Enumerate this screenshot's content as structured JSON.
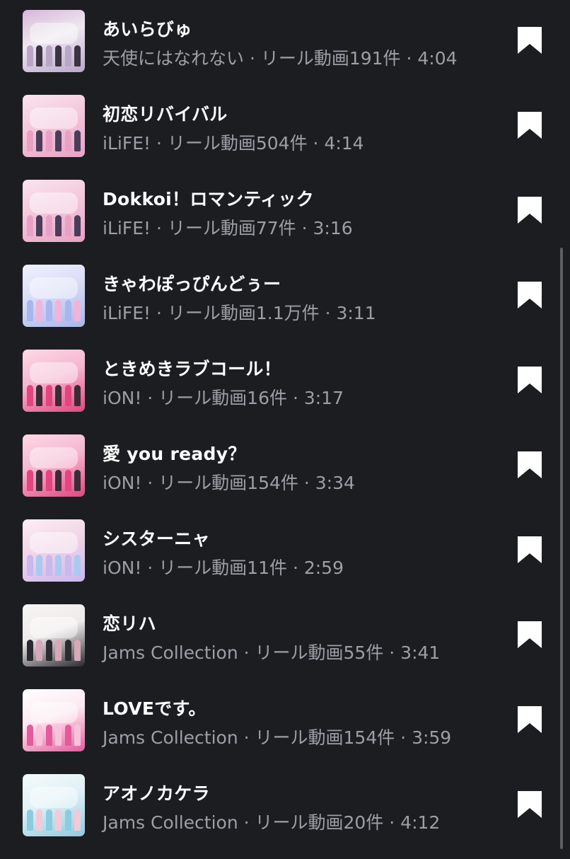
{
  "tracks": [
    {
      "title": "あいらびゅ",
      "subtitle": "天使にはなれない · リール動画191件 · 4:04",
      "thumb_colors": [
        "#eee8ef",
        "#b9a6c8",
        "#3a3440",
        "#d7b7d9"
      ],
      "bookmark_icon": "bookmark-icon"
    },
    {
      "title": "初恋リバイバル",
      "subtitle": "iLiFE! · リール動画504件 · 4:14",
      "thumb_colors": [
        "#f3c8dc",
        "#e8a1c4",
        "#4a3d58",
        "#fbe4ef"
      ],
      "bookmark_icon": "bookmark-icon"
    },
    {
      "title": "Dokkoi！ロマンティック",
      "subtitle": "iLiFE! · リール動画77件 · 3:16",
      "thumb_colors": [
        "#f3c8dc",
        "#e8a1c4",
        "#4a3d58",
        "#fbe4ef"
      ],
      "bookmark_icon": "bookmark-icon"
    },
    {
      "title": "きゃわぽっぴんどぅー",
      "subtitle": "iLiFE! · リール動画1.1万件 · 3:11",
      "thumb_colors": [
        "#d9dcf5",
        "#a8b6ee",
        "#f2b3d8",
        "#f0f2ff"
      ],
      "bookmark_icon": "bookmark-icon"
    },
    {
      "title": "ときめきラブコール！",
      "subtitle": "iON! · リール動画16件 · 3:17",
      "thumb_colors": [
        "#f4b6cf",
        "#e2457f",
        "#3b2b36",
        "#ffd9e6"
      ],
      "bookmark_icon": "bookmark-icon"
    },
    {
      "title": "愛 you ready？",
      "subtitle": "iON! · リール動画154件 · 3:34",
      "thumb_colors": [
        "#f4b6cf",
        "#e2457f",
        "#3b2b36",
        "#ffd9e6"
      ],
      "bookmark_icon": "bookmark-icon"
    },
    {
      "title": "シスターニャ",
      "subtitle": "iON! · リール動画11件 · 2:59",
      "thumb_colors": [
        "#f2d4e6",
        "#c9b8ee",
        "#a9c9f2",
        "#fbeff6"
      ],
      "bookmark_icon": "bookmark-icon"
    },
    {
      "title": "恋リハ",
      "subtitle": "Jams Collection · リール動画55件 · 3:41",
      "thumb_colors": [
        "#eeeaea",
        "#2b2b2f",
        "#d9a7b8",
        "#f7f4f4"
      ],
      "bookmark_icon": "bookmark-icon"
    },
    {
      "title": "LOVEです。",
      "subtitle": "Jams Collection · リール動画154件 · 3:59",
      "thumb_colors": [
        "#fbe9f1",
        "#e35b9a",
        "#f7c3da",
        "#ffffff"
      ],
      "bookmark_icon": "bookmark-icon"
    },
    {
      "title": "アオノカケラ",
      "subtitle": "Jams Collection · リール動画20件 · 4:12",
      "thumb_colors": [
        "#dff0f4",
        "#8ccbe0",
        "#f3c9d6",
        "#f5fbfd"
      ],
      "bookmark_icon": "bookmark-icon"
    }
  ]
}
